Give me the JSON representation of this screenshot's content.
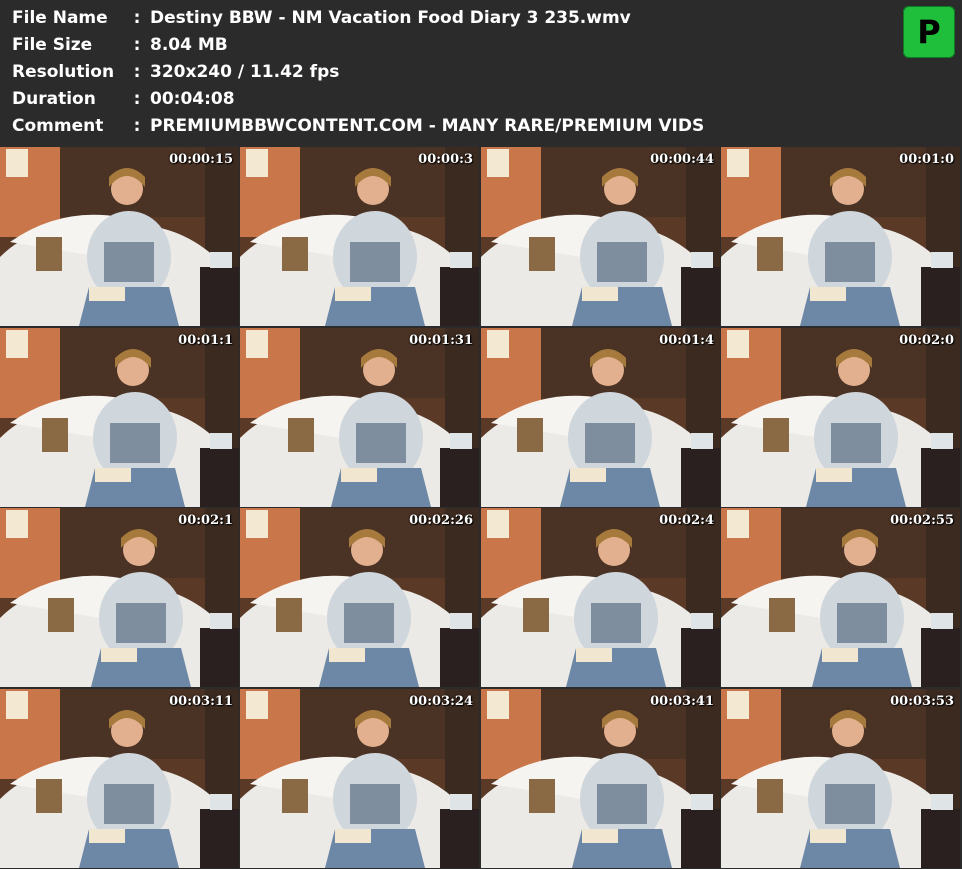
{
  "info": {
    "file_name_label": "File Name",
    "file_name_value": "Destiny BBW - NM Vacation Food Diary 3 235.wmv",
    "file_size_label": "File Size",
    "file_size_value": "8.04 MB",
    "resolution_label": "Resolution",
    "resolution_value": "320x240 / 11.42 fps",
    "duration_label": "Duration",
    "duration_value": "00:04:08",
    "comment_label": "Comment",
    "comment_value": "PREMIUMBBWCONTENT.COM - MANY RARE/PREMIUM VIDS",
    "separator": ":"
  },
  "logo": {
    "letter": "P",
    "color": "#1fbf3c"
  },
  "thumbnails": [
    {
      "timestamp": "00:00:15"
    },
    {
      "timestamp": "00:00:3"
    },
    {
      "timestamp": "00:00:44"
    },
    {
      "timestamp": "00:01:0"
    },
    {
      "timestamp": "00:01:1"
    },
    {
      "timestamp": "00:01:31"
    },
    {
      "timestamp": "00:01:4"
    },
    {
      "timestamp": "00:02:0"
    },
    {
      "timestamp": "00:02:1"
    },
    {
      "timestamp": "00:02:26"
    },
    {
      "timestamp": "00:02:4"
    },
    {
      "timestamp": "00:02:55"
    },
    {
      "timestamp": "00:03:11"
    },
    {
      "timestamp": "00:03:24"
    },
    {
      "timestamp": "00:03:41"
    },
    {
      "timestamp": "00:03:53"
    }
  ],
  "colors": {
    "background": "#2b2b2b",
    "text": "#ffffff"
  }
}
